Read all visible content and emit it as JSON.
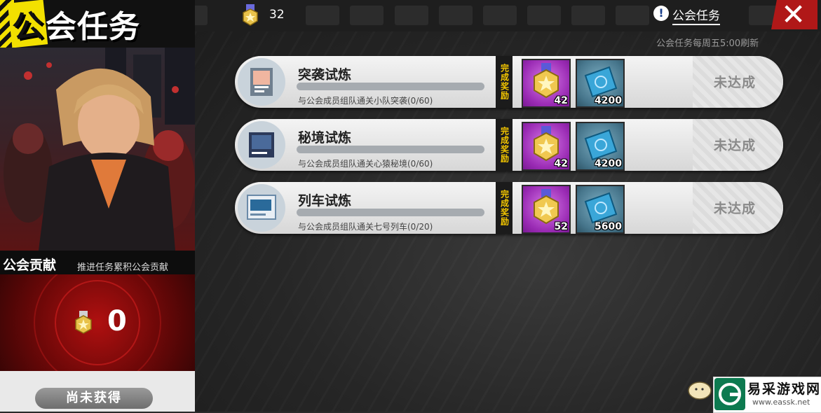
{
  "header": {
    "title": "公会任务",
    "coin_count": "32",
    "help_label": "公会任务",
    "close_icon": "close-icon"
  },
  "refresh_note": "公会任务每周五5:00刷新",
  "contribution": {
    "title": "公会贡献",
    "subtitle": "推进任务累积公会贡献",
    "value": "0",
    "status": "尚未获得"
  },
  "reward_tag": "完成奖励",
  "tasks": [
    {
      "name": "突袭试炼",
      "description": "与公会成员组队通关小队突袭(0/60)",
      "progress": 0,
      "reward_medal": "42",
      "reward_ticket": "4200",
      "state": "未达成"
    },
    {
      "name": "秘境试炼",
      "description": "与公会成员组队通关心猿秘境(0/60)",
      "progress": 0,
      "reward_medal": "42",
      "reward_ticket": "4200",
      "state": "未达成"
    },
    {
      "name": "列车试炼",
      "description": "与公会成员组队通关七号列车(0/20)",
      "progress": 0,
      "reward_medal": "52",
      "reward_ticket": "5600",
      "state": "未达成"
    }
  ],
  "watermark": {
    "title": "易采游戏网",
    "url": "www.eassk.net"
  },
  "colors": {
    "accent_yellow": "#f2e000",
    "close_red": "#b01818",
    "reward_gold": "#f2c500"
  }
}
